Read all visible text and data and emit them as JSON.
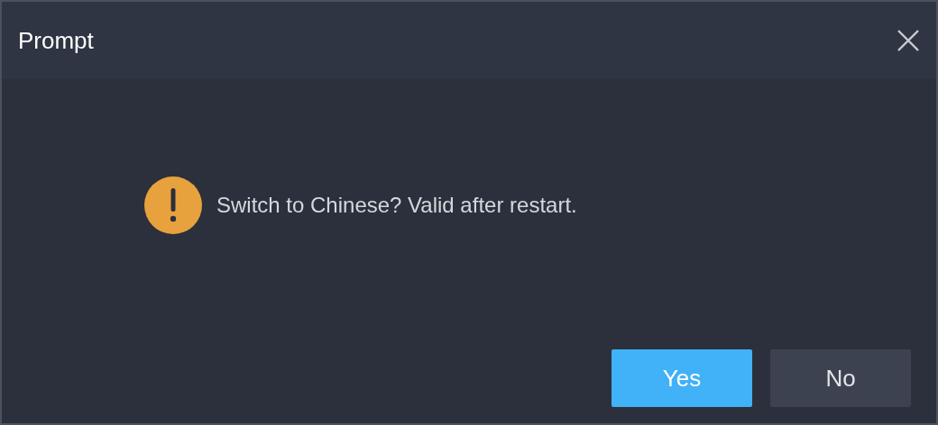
{
  "dialog": {
    "title": "Prompt",
    "message": "Switch to Chinese? Valid after restart.",
    "buttons": [
      {
        "label": "Yes",
        "kind": "primary"
      },
      {
        "label": "No",
        "kind": "secondary"
      }
    ]
  }
}
